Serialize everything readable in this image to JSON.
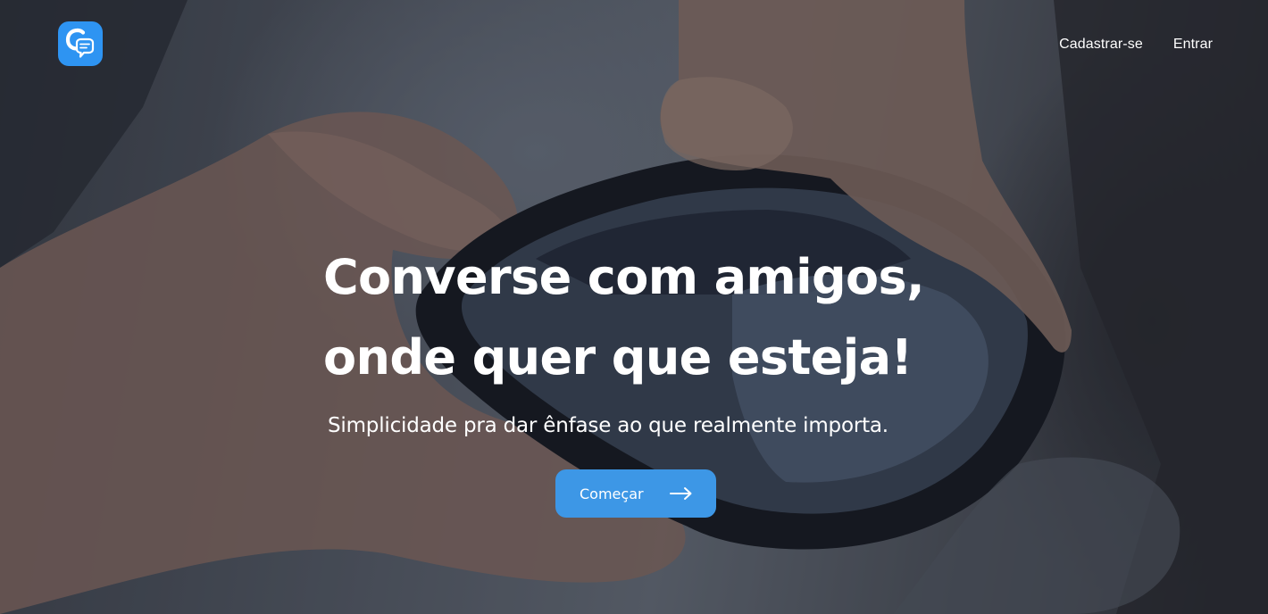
{
  "header": {
    "logo_icon": "chat-bubble-c-logo-icon",
    "nav": [
      {
        "label": "Cadastrar-se"
      },
      {
        "label": "Entrar"
      }
    ]
  },
  "hero": {
    "title_line1": "Converse com amigos,",
    "title_line2": "onde quer que esteja!",
    "subtitle": "Simplicidade pra dar ênfase ao que realmente importa.",
    "cta": {
      "label": "Começar",
      "icon": "arrow-right-icon"
    },
    "background_image": "hands-holding-smartphone-photo"
  },
  "colors": {
    "accent": "#3d97e6",
    "logo_bg": "#2e94f2",
    "text": "#ffffff"
  }
}
